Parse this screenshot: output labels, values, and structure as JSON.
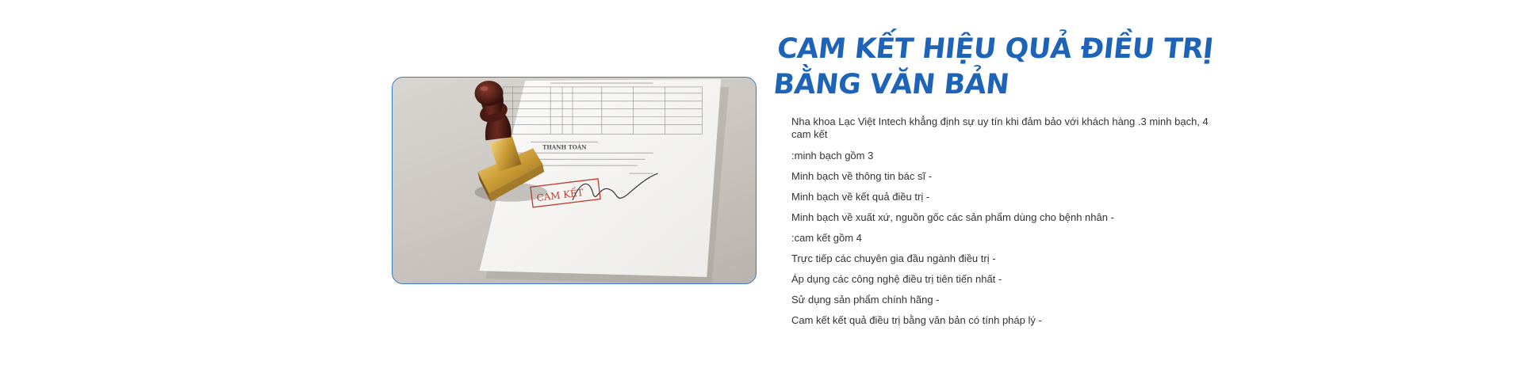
{
  "illustration": {
    "stamp_text": "CAM KẾT",
    "section_heading": "THANH TOÁN"
  },
  "section": {
    "title": "CAM KẾT HIỆU QUẢ ĐIỀU TRỊ BẰNG VĂN BẢN",
    "lines": [
      "Nha khoa Lạc Việt Intech khẳng định sự uy tín khi đảm bảo với khách hàng .3 minh bạch, 4 cam kết",
      ":minh bạch gồm 3",
      "Minh bạch về thông tin bác sĩ -",
      "Minh bạch về kết quả điều trị -",
      "Minh bạch về xuất xứ, nguồn gốc các sản phẩm dùng cho bệnh nhân -",
      ":cam kết gồm 4",
      "Trực tiếp các chuyên gia đầu ngành điều trị -",
      "Áp dụng các công nghệ điều trị tiên tiến nhất -",
      "Sử dụng sản phẩm chính hãng -",
      "Cam kết kết quả điều trị bằng văn bản có tính pháp lý -"
    ]
  }
}
